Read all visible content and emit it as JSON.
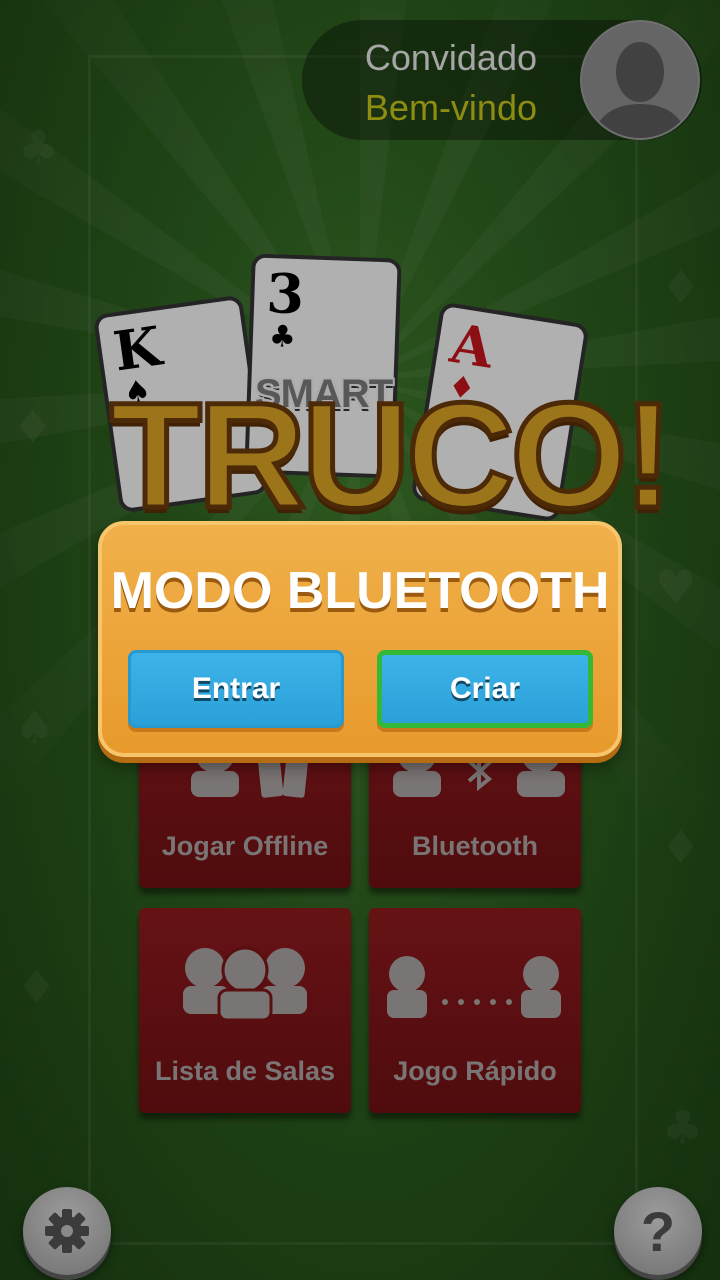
{
  "profile": {
    "name": "Convidado",
    "welcome": "Bem-vindo"
  },
  "logo": {
    "cards": [
      {
        "rank": "K",
        "suit": "♠"
      },
      {
        "rank": "3",
        "suit": "♣"
      },
      {
        "rank": "A",
        "suit": "♦"
      }
    ],
    "smart": "SMART",
    "truco": "TRUCO!"
  },
  "menu": {
    "tiles": [
      {
        "label": "Jogar Offline",
        "icon": "offline-players-cards-icon"
      },
      {
        "label": "Bluetooth",
        "icon": "bluetooth-players-icon"
      },
      {
        "label": "Lista de Salas",
        "icon": "group-icon"
      },
      {
        "label": "Jogo Rápido",
        "icon": "quick-match-icon"
      }
    ]
  },
  "modal": {
    "title": "MODO BLUETOOTH",
    "enter_label": "Entrar",
    "create_label": "Criar"
  },
  "corners": {
    "settings_icon": "gear-icon",
    "help_label": "?"
  },
  "colors": {
    "table_green": "#2d5f1f",
    "tile_red": "#8e1a1e",
    "modal_orange": "#f0b04a",
    "button_blue": "#2aa0d8",
    "selected_green": "#33b838",
    "welcome_yellow": "#c5c41a"
  }
}
